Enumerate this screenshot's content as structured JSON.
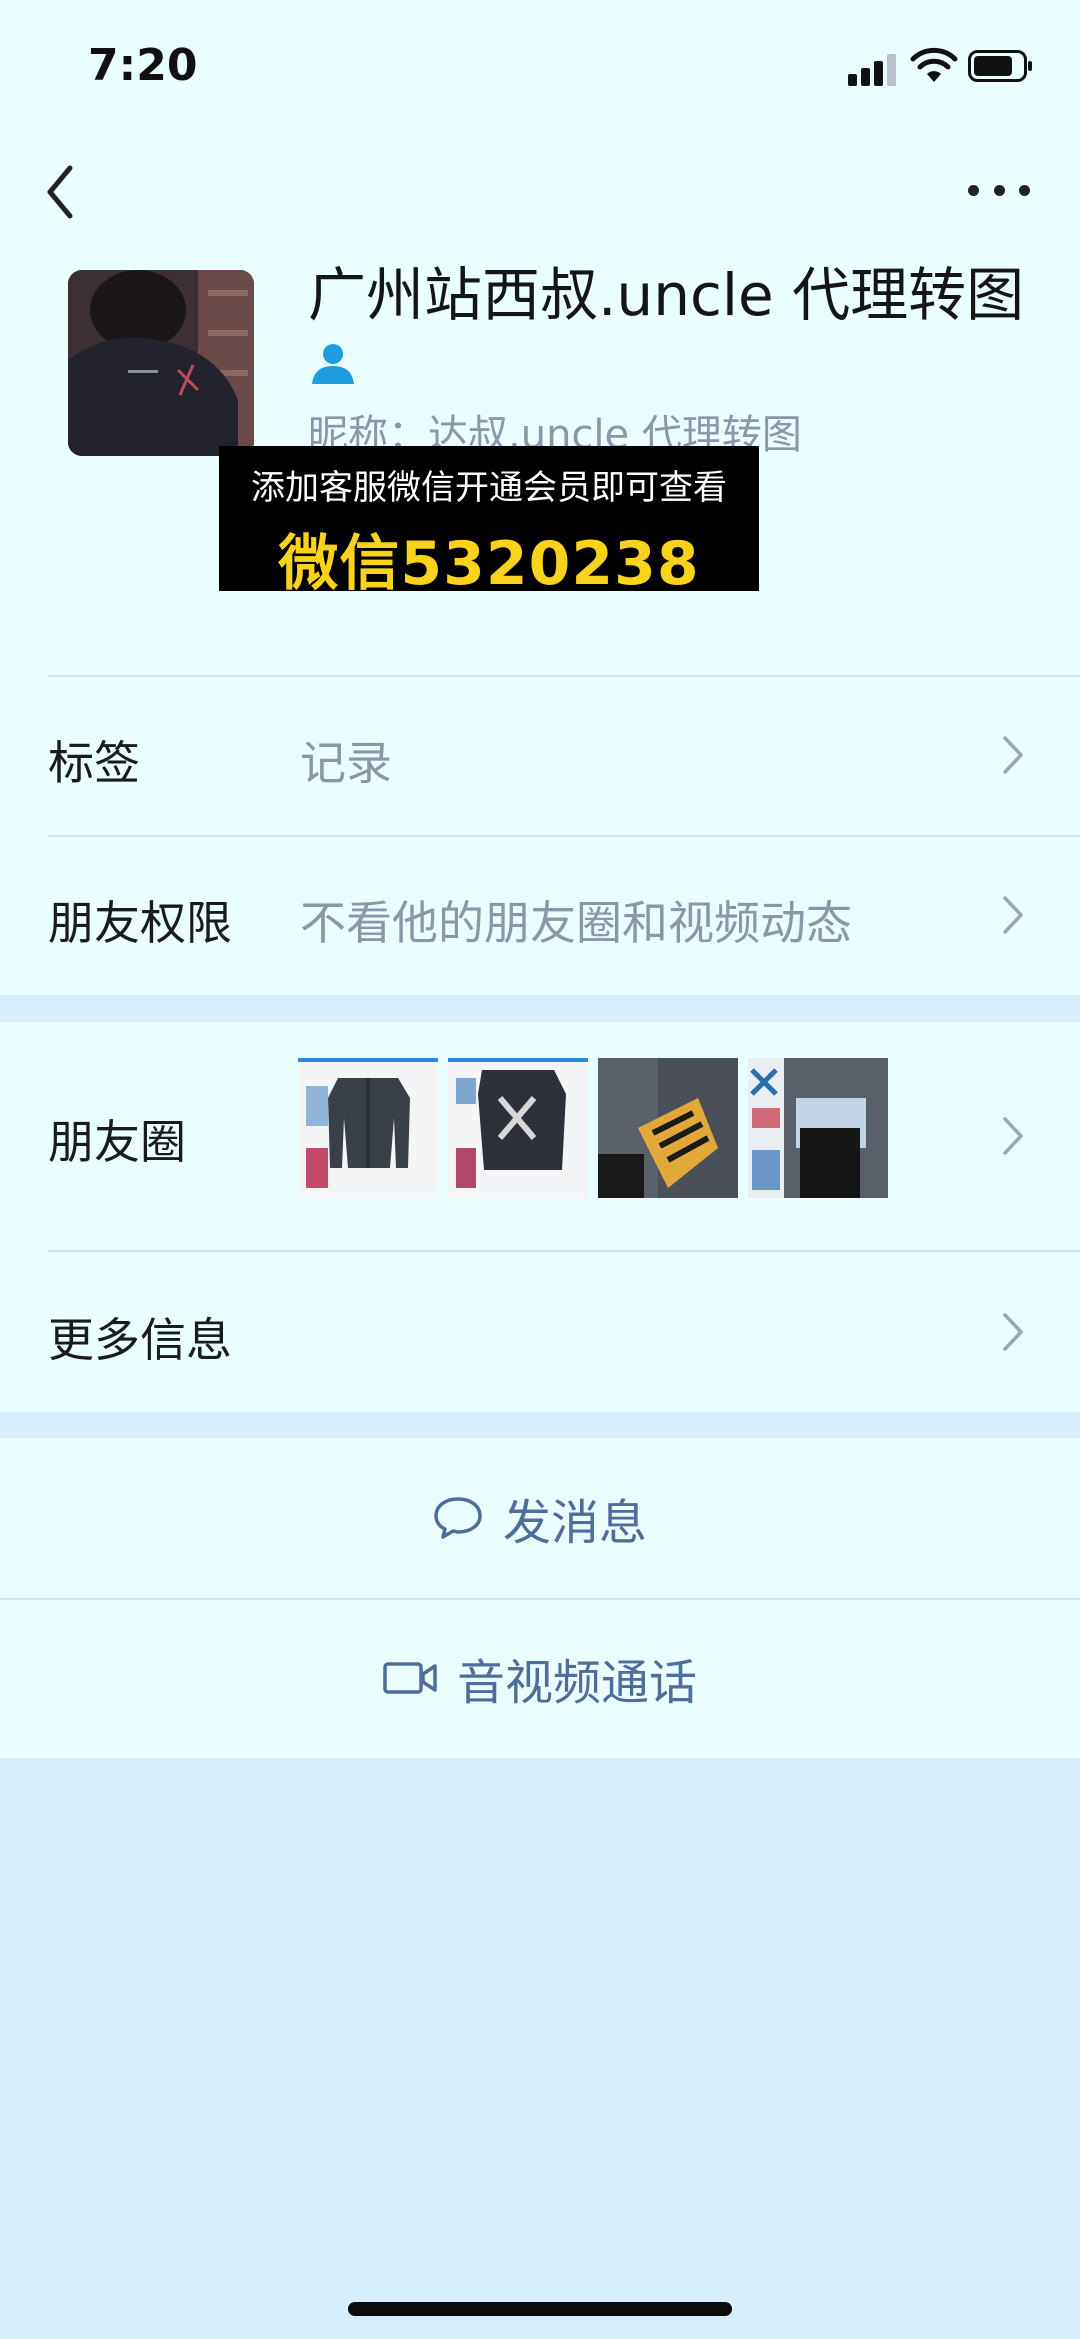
{
  "status_bar": {
    "time": "7:20"
  },
  "header": {
    "name": "广州站西叔.uncle 代理转图",
    "nickname": "昵称：达叔.uncle 代理转图"
  },
  "promo": {
    "line1": "添加客服微信开通会员即可查看",
    "line2": "微信5320238"
  },
  "rows": {
    "tag": {
      "label": "标签",
      "value": "记录"
    },
    "friend_permission": {
      "label": "朋友权限",
      "value": "不看他的朋友圈和视频动态"
    },
    "moments": {
      "label": "朋友圈"
    },
    "more_info": {
      "label": "更多信息"
    }
  },
  "actions": {
    "message": "发消息",
    "video_call": "音视频通话"
  },
  "icons": [
    "back-icon",
    "more-icon",
    "user-icon",
    "chevron-right-icon",
    "chat-bubble-icon",
    "video-camera-icon",
    "signal-icon",
    "wifi-icon",
    "battery-icon"
  ],
  "colors": {
    "background": "#d6eefb",
    "card": "#eafdff",
    "action_text": "#4d6e9a",
    "secondary_text": "#8b97a6",
    "promo_yellow": "#f8d21b"
  }
}
